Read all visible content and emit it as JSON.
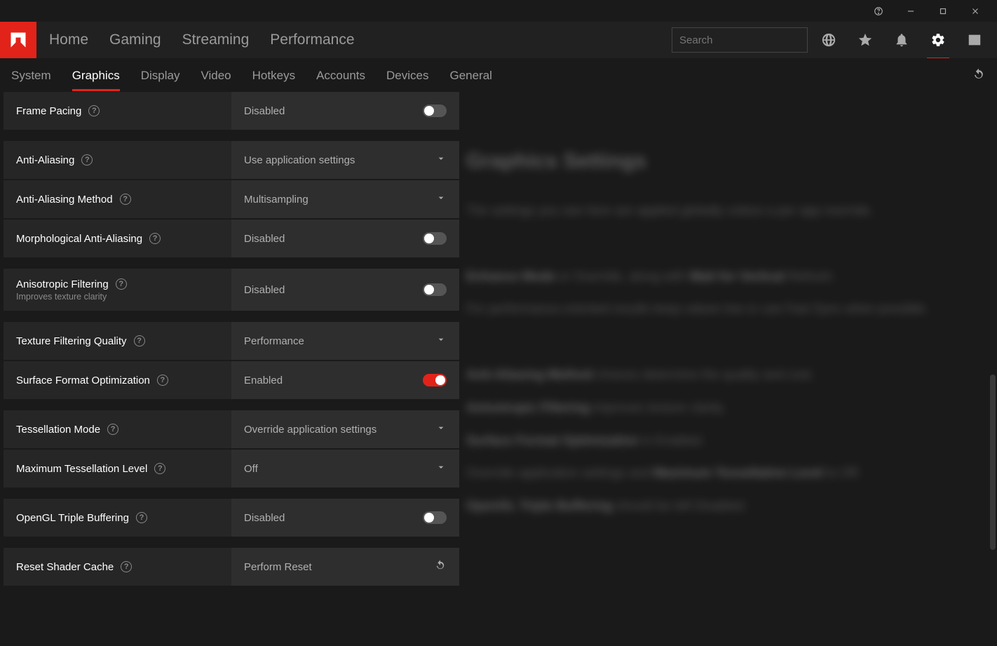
{
  "titlebar": {
    "help_icon": "help-circle",
    "minimize": "minimize",
    "maximize": "maximize",
    "close": "close"
  },
  "colors": {
    "accent": "#e2231a"
  },
  "header": {
    "nav": {
      "home": "Home",
      "gaming": "Gaming",
      "streaming": "Streaming",
      "performance": "Performance"
    },
    "search_placeholder": "Search"
  },
  "subnav": {
    "items": {
      "system": "System",
      "graphics": "Graphics",
      "display": "Display",
      "video": "Video",
      "hotkeys": "Hotkeys",
      "accounts": "Accounts",
      "devices": "Devices",
      "general": "General"
    },
    "active": "graphics"
  },
  "settings": {
    "frame_pacing": {
      "label": "Frame Pacing",
      "value": "Disabled",
      "enabled": false,
      "type": "toggle"
    },
    "anti_aliasing": {
      "label": "Anti-Aliasing",
      "value": "Use application settings",
      "type": "dropdown"
    },
    "aa_method": {
      "label": "Anti-Aliasing Method",
      "value": "Multisampling",
      "type": "dropdown"
    },
    "morph_aa": {
      "label": "Morphological Anti-Aliasing",
      "value": "Disabled",
      "enabled": false,
      "type": "toggle"
    },
    "aniso": {
      "label": "Anisotropic Filtering",
      "sublabel": "Improves texture clarity",
      "value": "Disabled",
      "enabled": false,
      "type": "toggle"
    },
    "tex_quality": {
      "label": "Texture Filtering Quality",
      "value": "Performance",
      "type": "dropdown"
    },
    "surf_opt": {
      "label": "Surface Format Optimization",
      "value": "Enabled",
      "enabled": true,
      "type": "toggle"
    },
    "tess_mode": {
      "label": "Tessellation Mode",
      "value": "Override application settings",
      "type": "dropdown"
    },
    "max_tess": {
      "label": "Maximum Tessellation Level",
      "value": "Off",
      "type": "dropdown"
    },
    "triple_buf": {
      "label": "OpenGL Triple Buffering",
      "value": "Disabled",
      "enabled": false,
      "type": "toggle"
    },
    "reset_shader": {
      "label": "Reset Shader Cache",
      "value": "Perform Reset",
      "type": "action"
    }
  },
  "help": {
    "title": "Graphics Settings",
    "body": "The settings you see here are applied globally unless a per-app override. Anti-Aliasing uses Enhance Mode or Override, along with Wait for Vertical Refresh. For performance-oriented results keep values low or use Fast Sync. Anti-Aliasing Method choices determine quality/performance tradeoff. Anisotropic Filtering improves texture clarity. Surface Format Optimization is Enabled. Override application settings and set Maximum Tessellation Level to Off. OpenGL Triple Buffering should be left Disabled."
  }
}
